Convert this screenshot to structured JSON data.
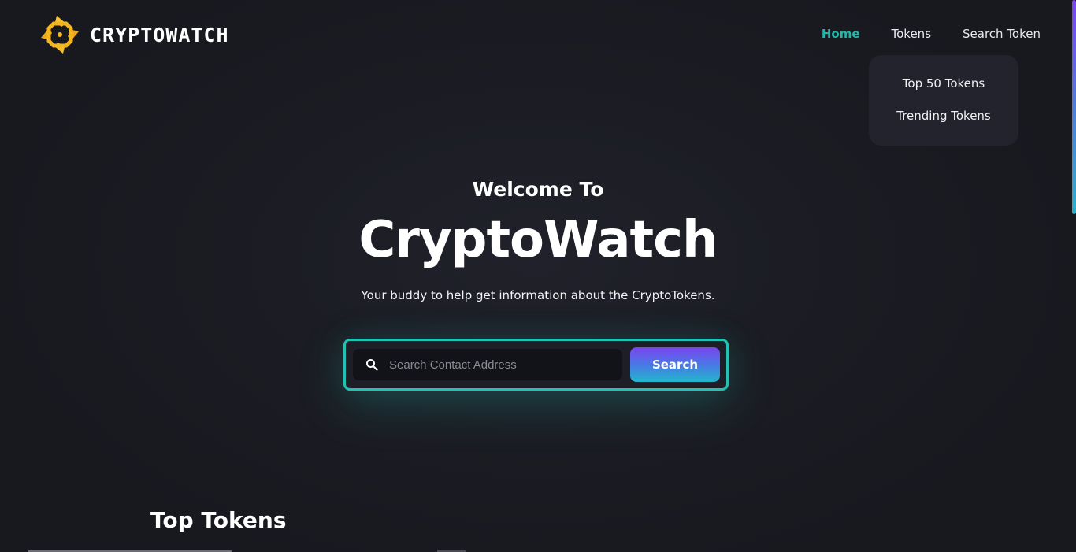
{
  "brand": {
    "name": "CRYPTOWATCH",
    "logo_icon": "cryptowatch-logo-icon",
    "colors": {
      "accent": "#22b5a8",
      "logo_yellow": "#f3b61f",
      "button_gradient_start": "#7b44ee",
      "button_gradient_end": "#22b6cc",
      "background": "#1a1b22"
    }
  },
  "nav": {
    "items": [
      {
        "label": "Home",
        "active": true
      },
      {
        "label": "Tokens",
        "active": false
      },
      {
        "label": "Search Token",
        "active": false
      }
    ],
    "dropdown": {
      "items": [
        {
          "label": "Top 50 Tokens"
        },
        {
          "label": "Trending Tokens"
        }
      ]
    }
  },
  "hero": {
    "welcome": "Welcome To",
    "title": "CryptoWatch",
    "subtitle": "Your buddy to help get information about the CryptoTokens."
  },
  "search": {
    "placeholder": "Search Contact Address",
    "value": "",
    "button_label": "Search",
    "icon": "search-icon"
  },
  "sections": {
    "top_tokens_title": "Top Tokens"
  }
}
